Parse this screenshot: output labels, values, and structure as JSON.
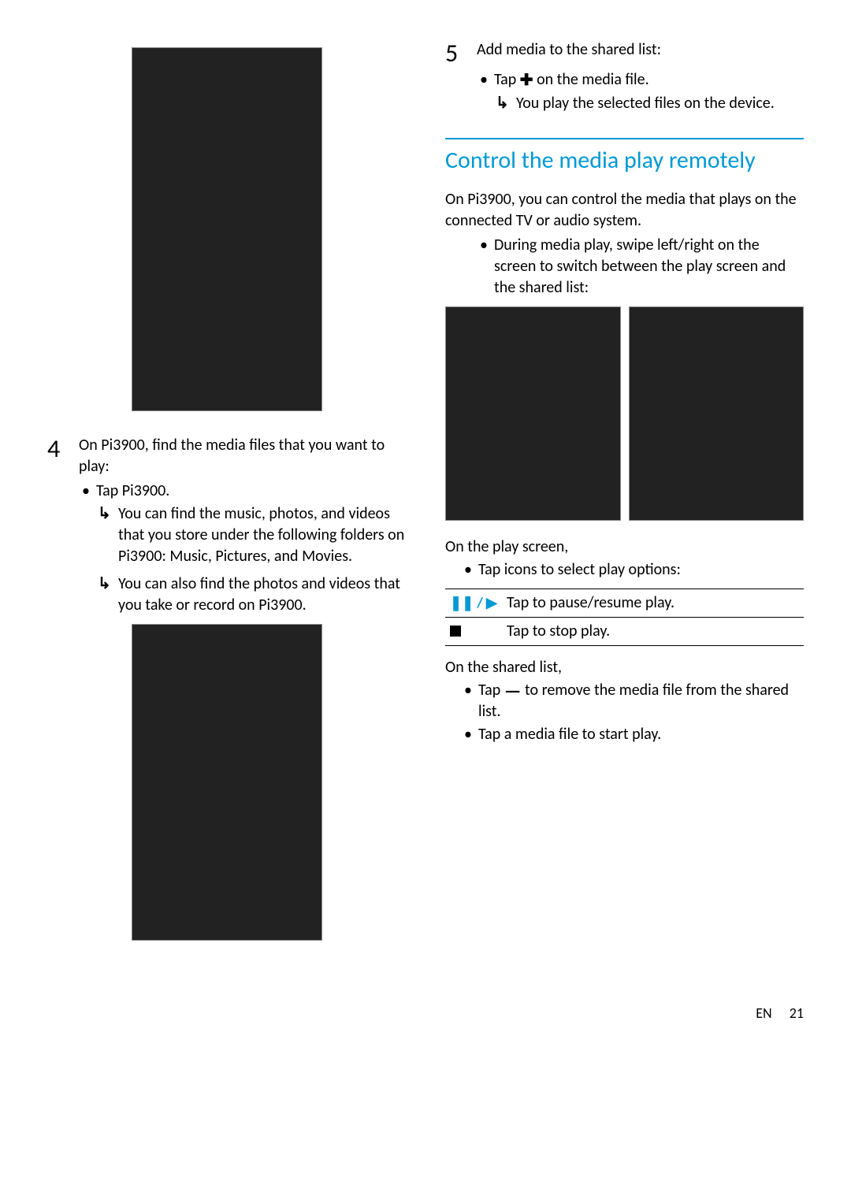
{
  "left": {
    "step4": {
      "num": "4",
      "lead_a": "On ",
      "device": "Pi3900",
      "lead_b": ", find the media files that you want to play:",
      "bullet1_a": "Tap ",
      "bullet1_b": "Pi3900",
      "bullet1_c": ".",
      "arrow1_a": "You can find the music, photos, and videos that you store under the following folders on ",
      "arrow1_b": "Pi3900",
      "arrow1_c": ": ",
      "arrow1_d": "Music",
      "arrow1_e": ", ",
      "arrow1_f": "Pictures",
      "arrow1_g": ", and ",
      "arrow1_h": "Movies",
      "arrow1_i": ".",
      "arrow2_a": "You can also find the photos and videos that you take or record on ",
      "arrow2_b": "Pi3900",
      "arrow2_c": "."
    }
  },
  "right": {
    "step5": {
      "num": "5",
      "lead": "Add media to the shared list:",
      "bullet1_a": "Tap ",
      "bullet1_b": " on the media file.",
      "arrow1": "You play the selected files on the device."
    },
    "section_title": "Control the media play remotely",
    "intro_a": "On ",
    "intro_device": "Pi3900",
    "intro_b": ", you can control the media that plays on the connected TV or audio system.",
    "intro_bullet": "During media play, swipe left/right on the screen to switch between the play screen and the shared list:",
    "play_heading": "On the play screen,",
    "play_bullet": "Tap icons to select play options:",
    "table": {
      "row1_desc": "Tap to pause/resume play.",
      "row2_desc": "Tap to stop play."
    },
    "shared_heading": "On the shared list,",
    "shared_b1_a": "Tap ",
    "shared_b1_b": " to remove the media file from the shared list.",
    "shared_b2": "Tap a media file to start play."
  },
  "footer": {
    "lang": "EN",
    "page": "21"
  }
}
